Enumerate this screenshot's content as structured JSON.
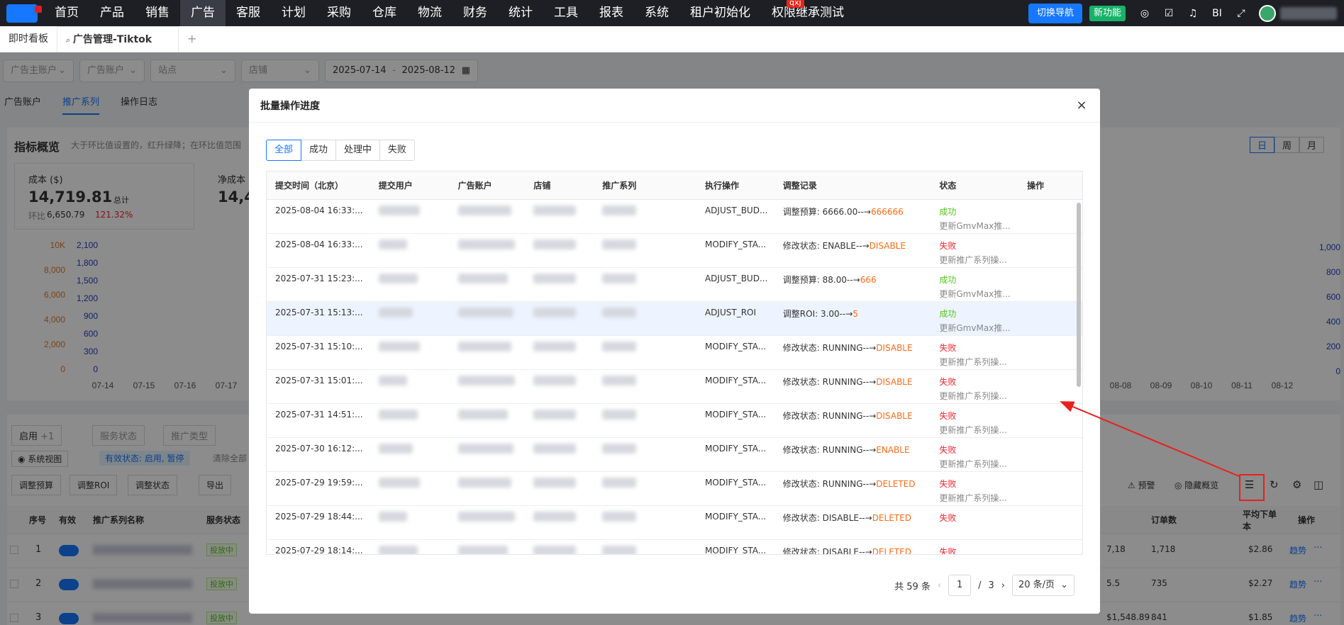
{
  "nav": {
    "items": [
      "首页",
      "产品",
      "销售",
      "广告",
      "客服",
      "计划",
      "采购",
      "仓库",
      "物流",
      "财务",
      "统计",
      "工具",
      "报表",
      "系统",
      "租户初始化",
      "权限继承测试"
    ],
    "active_index": 3,
    "badge": "qxj",
    "switch_nav": "切换导航",
    "new_feature": "新功能",
    "bi": "BI"
  },
  "tabs": {
    "home": "即时看板",
    "current": "广告管理-Tiktok",
    "add": "+"
  },
  "filters": {
    "f1": "广告主账户",
    "f2": "广告账户",
    "f3": "站点",
    "f4": "店铺",
    "date_start": "2025-07-14",
    "date_sep": "-",
    "date_end": "2025-08-12"
  },
  "subtabs": [
    "广告账户",
    "推广系列",
    "操作日志"
  ],
  "bg": {
    "overview": "指标概览",
    "hint": "大于环比值设置的，红升绿降；在环比值范围",
    "cost_label": "成本 ($)",
    "cost_value": "14,719.81",
    "cost_total": "总计",
    "cost_ring": "环比",
    "cost_ring_value": "6,650.79",
    "cost_ring_pct": "121.32%",
    "netcost_label": "净成本",
    "netcost_value": "14,4",
    "day": "日",
    "week": "周",
    "month": "月",
    "axis_left": [
      "10K",
      "8,000",
      "6,000",
      "4,000",
      "2,000",
      "0"
    ],
    "axis_left2": [
      "2,100",
      "1,800",
      "1,500",
      "1,200",
      "900",
      "600",
      "300",
      "0"
    ],
    "axis_right": [
      "1,000",
      "800",
      "600",
      "400",
      "200",
      "0"
    ],
    "dates_left": [
      "07-14",
      "07-15",
      "07-16",
      "07-17"
    ],
    "dates_right": [
      "08-08",
      "08-09",
      "08-10",
      "08-11",
      "08-12"
    ],
    "enable": "启用",
    "enable_count": "+1",
    "service_status": "服务状态",
    "promo_type": "推广类型",
    "system_view": "系统视图",
    "valid_status": "有效状态: 启用, 暂停",
    "clear_all": "清除全部",
    "adjust_budget": "调整预算",
    "adjust_roi": "调整ROI",
    "adjust_status": "调整状态",
    "export": "导出",
    "warn": "预警",
    "hide_overview": "隐藏概览",
    "col_no": "序号",
    "col_valid": "有效",
    "col_name": "推广系列名称",
    "col_service": "服务状态",
    "col_orders": "订单数",
    "col_avg": "平均下单本",
    "col_op": "操作",
    "rows": [
      {
        "no": "1",
        "tag": "投放中",
        "v1": "7,18",
        "orders": "1,718",
        "avg": "$2.86",
        "op": "趋势"
      },
      {
        "no": "2",
        "tag": "投放中",
        "v1": "5.5",
        "orders": "735",
        "avg": "$2.27",
        "op": "趋势"
      },
      {
        "no": "3",
        "tag": "投放中",
        "v1": "$1,548.89",
        "orders": "841",
        "avg": "$1.85",
        "op": "趋势"
      }
    ]
  },
  "modal": {
    "title": "批量操作进度",
    "close": "×",
    "segments": [
      "全部",
      "成功",
      "处理中",
      "失败"
    ],
    "headers": [
      "提交时间（北京）",
      "提交用户",
      "广告账户",
      "店铺",
      "推广系列",
      "执行操作",
      "调整记录",
      "状态",
      "操作"
    ],
    "rows": [
      {
        "time": "2025-08-04 16:33:...",
        "op": "ADJUST_BUD...",
        "rec_prefix": "调整预算: 6666.00--→",
        "rec_value": "666666",
        "status": "成功",
        "status_type": "success",
        "detail": "更新GmvMax推..."
      },
      {
        "time": "2025-08-04 16:33:...",
        "op": "MODIFY_STA...",
        "rec_prefix": "修改状态: ENABLE--→",
        "rec_value": "DISABLE",
        "status": "失败",
        "status_type": "fail",
        "detail": "更新推广系列操..."
      },
      {
        "time": "2025-07-31 15:23:...",
        "op": "ADJUST_BUD...",
        "rec_prefix": "调整预算: 88.00--→",
        "rec_value": "666",
        "status": "成功",
        "status_type": "success",
        "detail": "更新GmvMax推..."
      },
      {
        "time": "2025-07-31 15:13:...",
        "op": "ADJUST_ROI",
        "rec_prefix": "调整ROI: 3.00--→",
        "rec_value": "5",
        "status": "成功",
        "status_type": "success",
        "detail": "更新GmvMax推..."
      },
      {
        "time": "2025-07-31 15:10:...",
        "op": "MODIFY_STA...",
        "rec_prefix": "修改状态: RUNNING--→",
        "rec_value": "DISABLE",
        "status": "失败",
        "status_type": "fail",
        "detail": "更新推广系列操..."
      },
      {
        "time": "2025-07-31 15:01:...",
        "op": "MODIFY_STA...",
        "rec_prefix": "修改状态: RUNNING--→",
        "rec_value": "DISABLE",
        "status": "失败",
        "status_type": "fail",
        "detail": "更新推广系列操..."
      },
      {
        "time": "2025-07-31 14:51:...",
        "op": "MODIFY_STA...",
        "rec_prefix": "修改状态: RUNNING--→",
        "rec_value": "DISABLE",
        "status": "失败",
        "status_type": "fail",
        "detail": "更新推广系列操..."
      },
      {
        "time": "2025-07-30 16:12:...",
        "op": "MODIFY_STA...",
        "rec_prefix": "修改状态: RUNNING--→",
        "rec_value": "ENABLE",
        "status": "失败",
        "status_type": "fail",
        "detail": "更新推广系列操..."
      },
      {
        "time": "2025-07-29 19:59:...",
        "op": "MODIFY_STA...",
        "rec_prefix": "修改状态: RUNNING--→",
        "rec_value": "DELETED",
        "status": "失败",
        "status_type": "fail",
        "detail": "更新推广系列操..."
      },
      {
        "time": "2025-07-29 18:44:...",
        "op": "MODIFY_STA...",
        "rec_prefix": "修改状态: DISABLE--→",
        "rec_value": "DELETED",
        "status": "失败",
        "status_type": "fail",
        "detail": ""
      },
      {
        "time": "2025-07-29 18:14:...",
        "op": "MODIFY_STA...",
        "rec_prefix": "修改状态: DISABLE--→",
        "rec_value": "DELETED",
        "status": "失败",
        "status_type": "fail",
        "detail": ""
      }
    ],
    "pager": {
      "total": "共 59 条",
      "prev": "‹",
      "page": "1",
      "sep": "/",
      "pages": "3",
      "next": "›",
      "size": "20 条/页"
    }
  },
  "colors": {
    "accent": "#1677ff",
    "success": "#52c41a",
    "fail": "#f5222d",
    "highlight": "#fa6b16"
  }
}
